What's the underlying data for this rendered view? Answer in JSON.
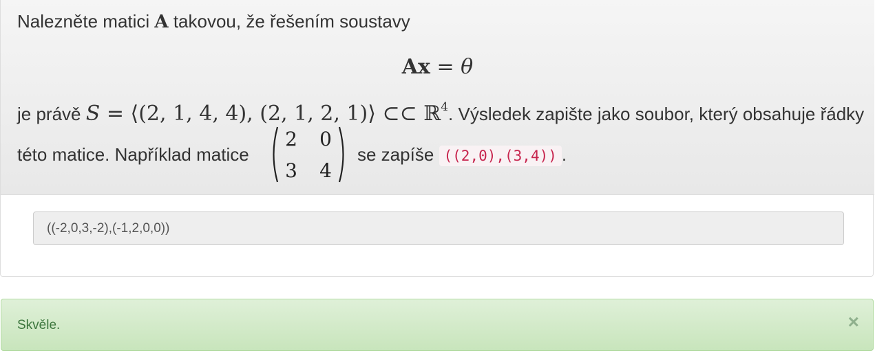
{
  "problem": {
    "intro": "Nalezněte matici ",
    "matrix_symbol": "A",
    "intro_tail": " takovou, že řešením soustavy",
    "equation_lhs": "Ax",
    "equation_eq": " = ",
    "equation_rhs": "θ",
    "line3_start": "je právě ",
    "set_symbol": "S",
    "set_definition": " = ⟨(2, 1, 4, 4), (2, 1, 2, 1)⟩ ⊂⊂ ",
    "field": "ℝ",
    "field_exponent": "4",
    "line3_tail": ". Výsledek zapište jako soubor, který obsahuje řádky",
    "line4_start": "této matice. Například matice",
    "example_matrix": [
      [
        "2",
        "0"
      ],
      [
        "3",
        "4"
      ]
    ],
    "line4_mid": "se zapíše ",
    "example_code": "((2,0),(3,4))",
    "line4_end": "."
  },
  "answer": {
    "value": "((-2,0,3,-2),(-1,2,0,0))"
  },
  "feedback": {
    "message": "Skvěle.",
    "close_label": "×"
  }
}
